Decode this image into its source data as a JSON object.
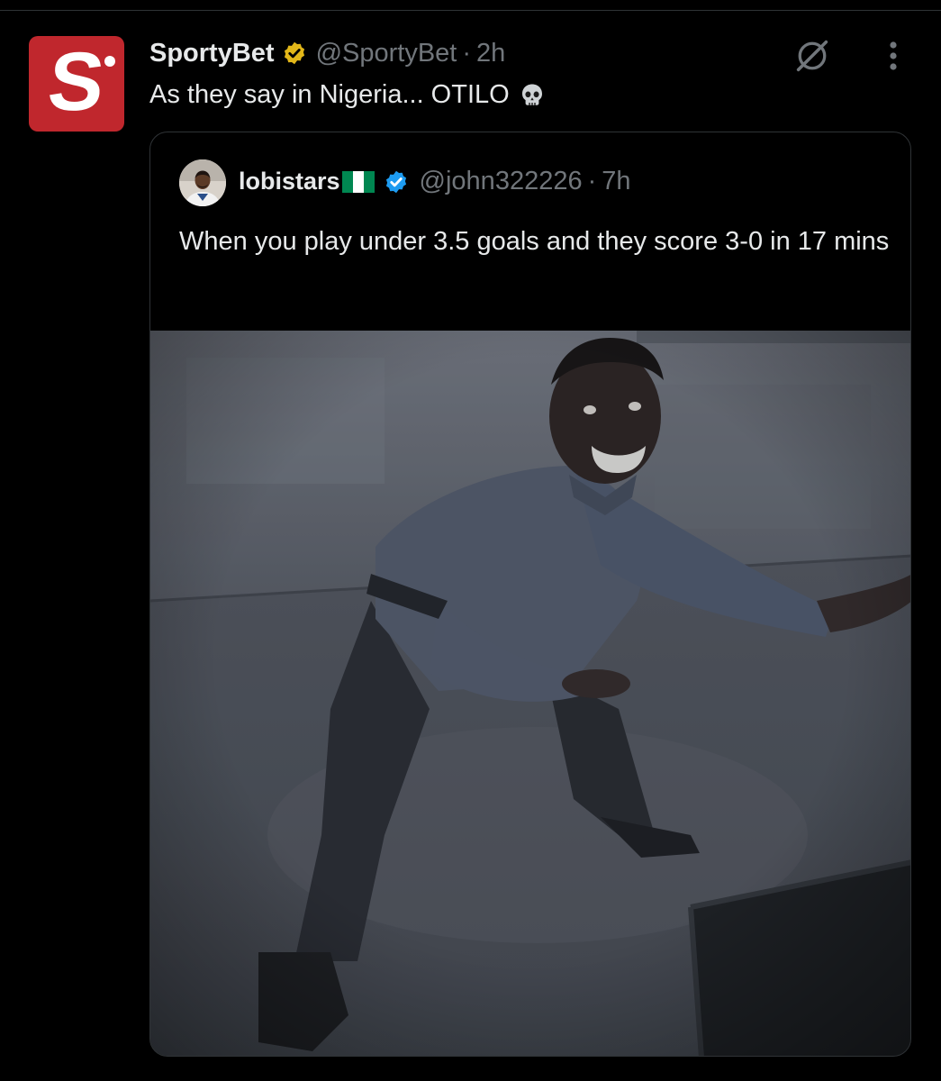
{
  "tweet": {
    "display_name": "SportyBet",
    "handle": "@SportyBet",
    "separator": "·",
    "time": "2h",
    "text": "As they say in Nigeria... OTILO",
    "avatar_letter": "S",
    "verified_badge": "gold-check-icon",
    "emoji": "skull-icon"
  },
  "actions": {
    "grok_icon": "grok-icon",
    "more_icon": "more-vertical-icon"
  },
  "quote": {
    "display_name": "lobistars",
    "flag": "nigeria-flag-icon",
    "verified_badge": "blue-check-icon",
    "handle": "@john322226",
    "separator": "·",
    "time": "7h",
    "text": "When you play under 3.5 goals and they score 3-0 in 17 mins",
    "media": "meme-photo"
  },
  "colors": {
    "background": "#000000",
    "text_primary": "#e7e9ea",
    "text_secondary": "#71767b",
    "border": "#2f3336",
    "brand_red": "#c0272d",
    "gold_badge": "#e2b719",
    "blue_badge": "#1d9bf0",
    "flag_green": "#008751"
  }
}
